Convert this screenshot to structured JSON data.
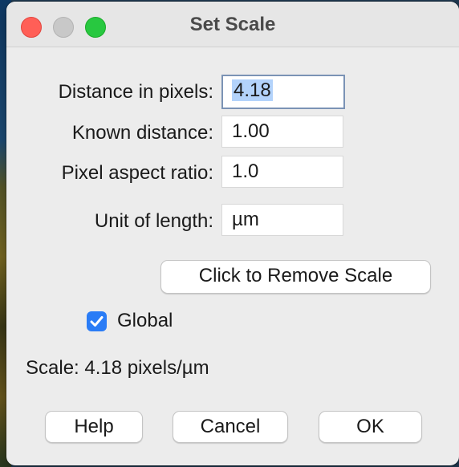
{
  "window": {
    "title": "Set Scale"
  },
  "fields": {
    "distance_label": "Distance in pixels:",
    "distance_value": "4.18",
    "known_label": "Known distance:",
    "known_value": "1.00",
    "aspect_label": "Pixel aspect ratio:",
    "aspect_value": "1.0",
    "unit_label": "Unit of length:",
    "unit_value": "µm"
  },
  "remove_scale_label": "Click to Remove Scale",
  "global": {
    "label": "Global",
    "checked": true
  },
  "scale_status": "Scale: 4.18 pixels/µm",
  "buttons": {
    "help": "Help",
    "cancel": "Cancel",
    "ok": "OK"
  },
  "colors": {
    "accent": "#2a7cf6",
    "selection": "#b3d3fb",
    "close": "#ff5f57",
    "maximize": "#28c840"
  }
}
